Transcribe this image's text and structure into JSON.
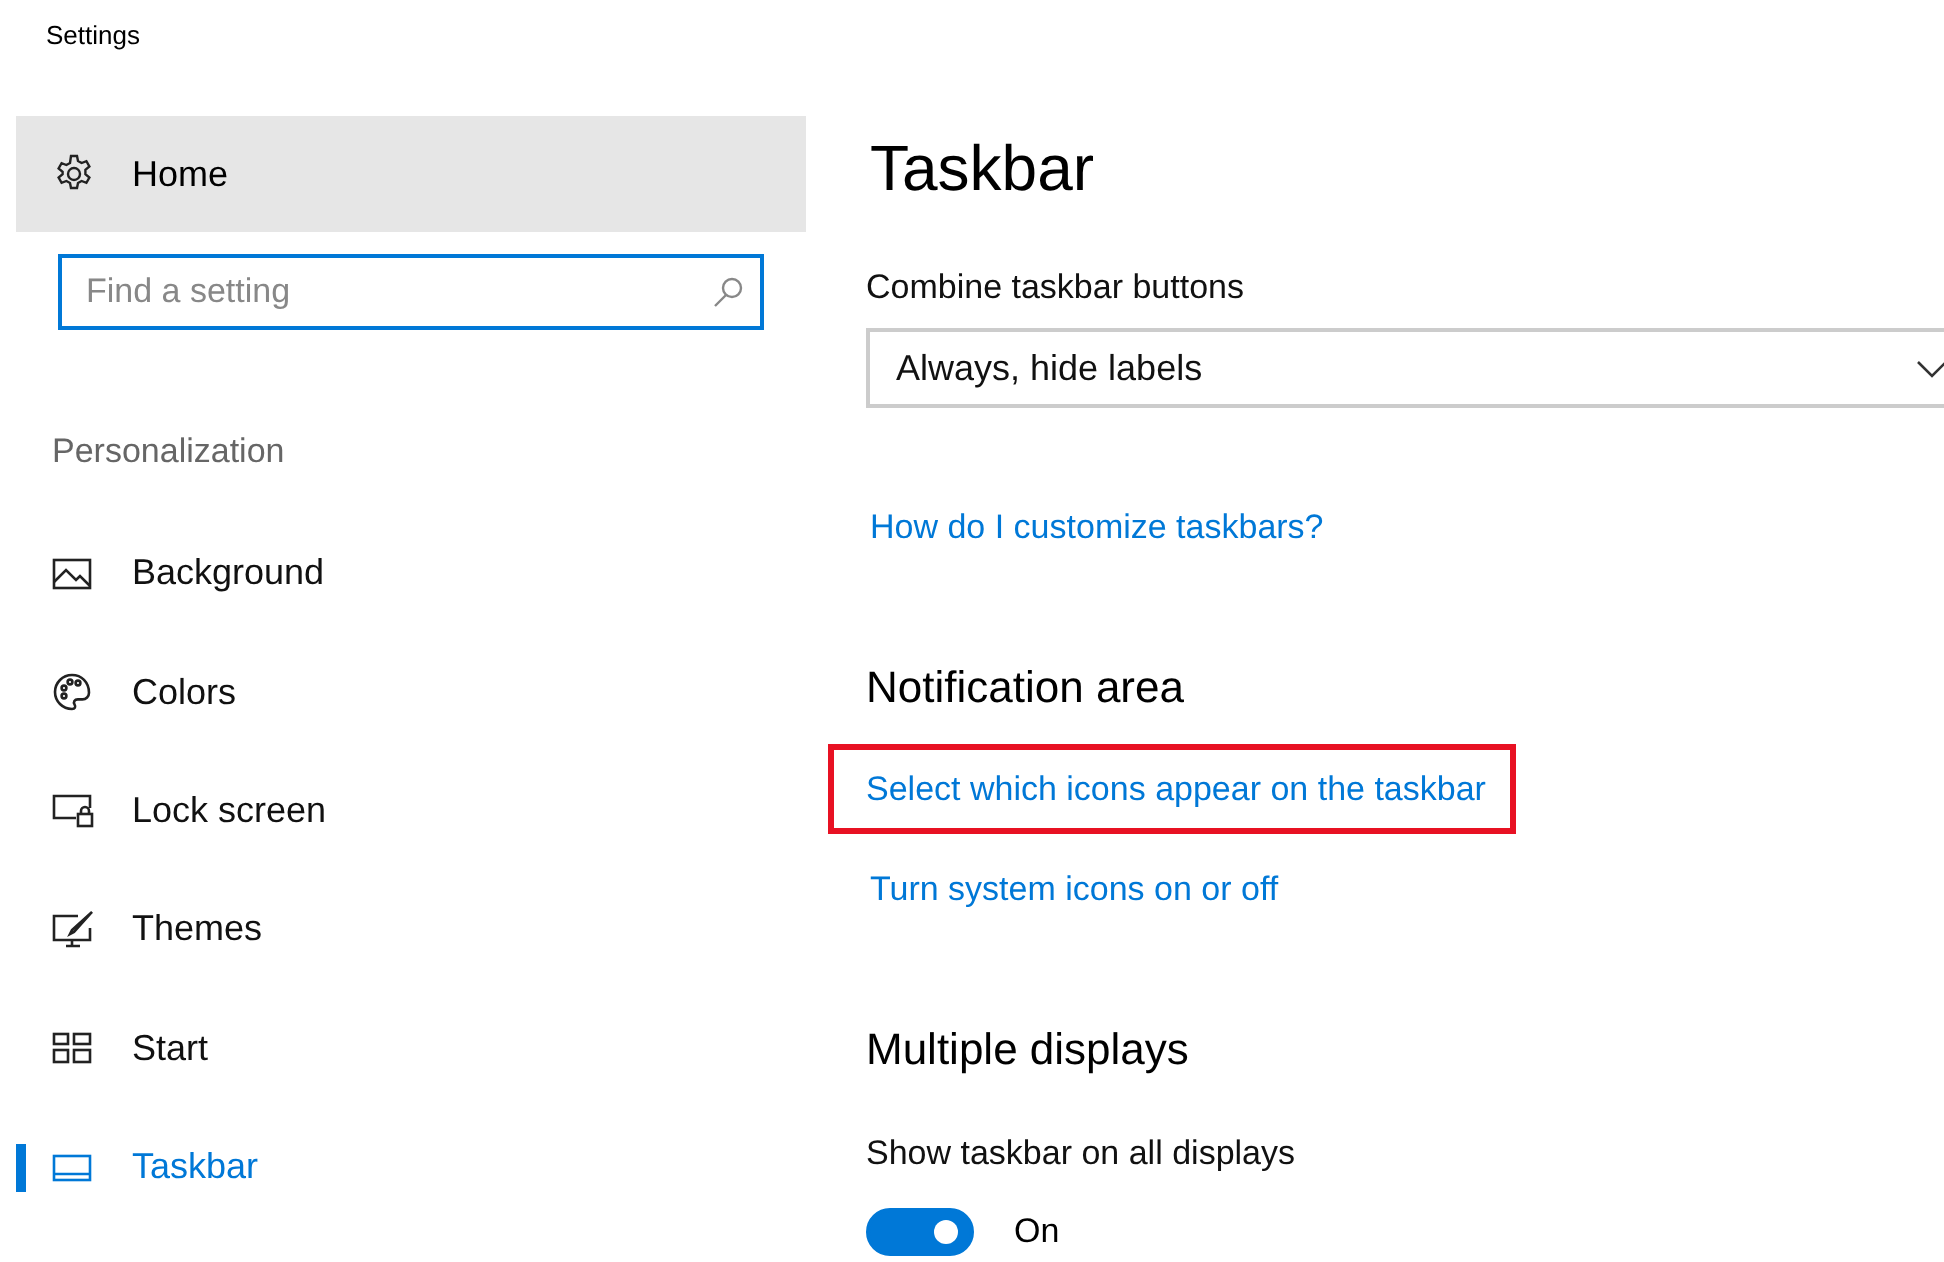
{
  "window": {
    "title": "Settings"
  },
  "sidebar": {
    "home": {
      "label": "Home",
      "selected": false
    },
    "search": {
      "placeholder": "Find a setting",
      "focused": true
    },
    "section": "Personalization",
    "items": [
      {
        "label": "Background",
        "selected": false
      },
      {
        "label": "Colors",
        "selected": false
      },
      {
        "label": "Lock screen",
        "selected": false
      },
      {
        "label": "Themes",
        "selected": false
      },
      {
        "label": "Start",
        "selected": false
      },
      {
        "label": "Taskbar",
        "selected": true
      }
    ]
  },
  "content": {
    "title": "Taskbar",
    "items": [
      {
        "kind": "label",
        "text": "Combine taskbar buttons"
      },
      {
        "kind": "dropdown",
        "value": "Always, hide labels"
      },
      {
        "kind": "link",
        "text": "How do I customize taskbars?",
        "highlighted": false
      },
      {
        "kind": "heading",
        "text": "Notification area"
      },
      {
        "kind": "link",
        "text": "Select which icons appear on the taskbar",
        "highlighted": true
      },
      {
        "kind": "link",
        "text": "Turn system icons on or off",
        "highlighted": false
      },
      {
        "kind": "heading",
        "text": "Multiple displays"
      },
      {
        "kind": "label",
        "text": "Show taskbar on all displays"
      },
      {
        "kind": "toggle",
        "on": true,
        "text": "On"
      }
    ]
  }
}
